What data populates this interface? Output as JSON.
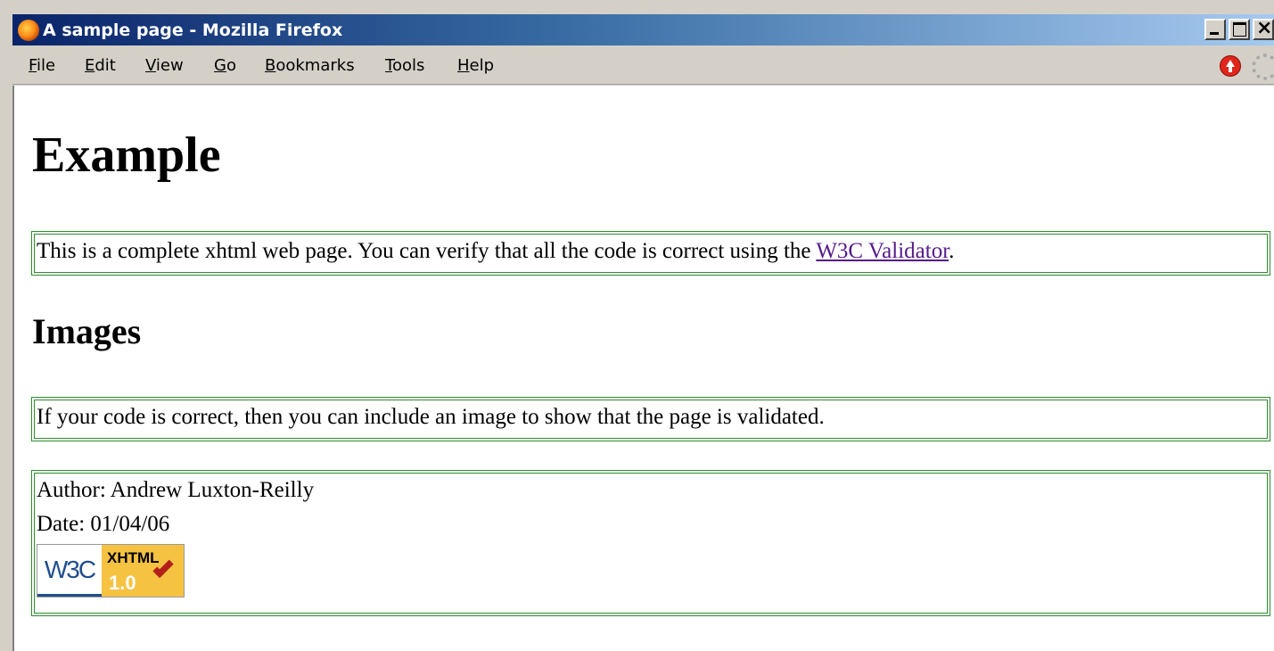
{
  "window": {
    "title": "A sample page - Mozilla Firefox"
  },
  "menu": {
    "items": [
      {
        "accel": "F",
        "rest": "ile"
      },
      {
        "accel": "E",
        "rest": "dit"
      },
      {
        "accel": "V",
        "rest": "iew"
      },
      {
        "accel": "G",
        "rest": "o"
      },
      {
        "accel": "B",
        "rest": "ookmarks"
      },
      {
        "accel": "T",
        "rest": "ools"
      },
      {
        "accel": "H",
        "rest": "elp"
      }
    ]
  },
  "page": {
    "heading": "Example",
    "intro_text": "This is a complete xhtml web page. You can verify that all the code is correct using the ",
    "intro_link": "W3C Validator",
    "intro_end": ".",
    "subheading": "Images",
    "images_text": "If your code is correct, then you can include an image to show that the page is validated.",
    "author": "Author: Andrew Luxton-Reilly",
    "date": "Date: 01/04/06",
    "badge": {
      "w3c": "W3C",
      "xhtml": "XHTML",
      "version": "1.0"
    }
  },
  "colors": {
    "box_border": "#2e8b2e",
    "link": "#551a8b"
  }
}
